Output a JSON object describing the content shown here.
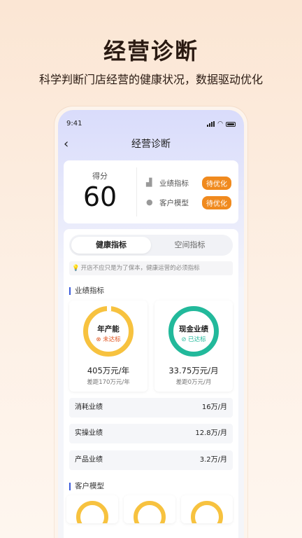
{
  "hero": {
    "title": "经营诊断",
    "subtitle": "科学判断门店经营的健康状况，数据驱动优化"
  },
  "status_bar": {
    "time": "9:41"
  },
  "nav": {
    "title": "经营诊断",
    "back_icon": "chevron-left-icon"
  },
  "score": {
    "label": "得分",
    "value": "60",
    "metrics": [
      {
        "label": "业绩指标",
        "badge": "待优化",
        "icon": "chart-icon"
      },
      {
        "label": "客户模型",
        "badge": "待优化",
        "icon": "users-icon"
      }
    ]
  },
  "tabs": [
    {
      "label": "健康指标",
      "active": true
    },
    {
      "label": "空间指标",
      "active": false
    }
  ],
  "tip": "开店不应只是为了保本，健康运营的必须指标",
  "sections": {
    "performance": "业绩指标",
    "customer": "客户模型"
  },
  "kpis": [
    {
      "title": "年产能",
      "status": "未达标",
      "status_type": "bad",
      "value": "405万元/年",
      "gap": "差距170万元/年",
      "color": "#f7c23f"
    },
    {
      "title": "现金业绩",
      "status": "已达标",
      "status_type": "good",
      "value": "33.75万元/月",
      "gap": "差距0万元/月",
      "color": "#22b99b"
    }
  ],
  "list": [
    {
      "label": "消耗业绩",
      "value": "16万/月"
    },
    {
      "label": "实操业绩",
      "value": "12.8万/月"
    },
    {
      "label": "产品业绩",
      "value": "3.2万/月"
    }
  ],
  "colors": {
    "accent": "#f08a1e",
    "good": "#22b99b",
    "warn": "#f7c23f",
    "bad": "#e0541f"
  }
}
